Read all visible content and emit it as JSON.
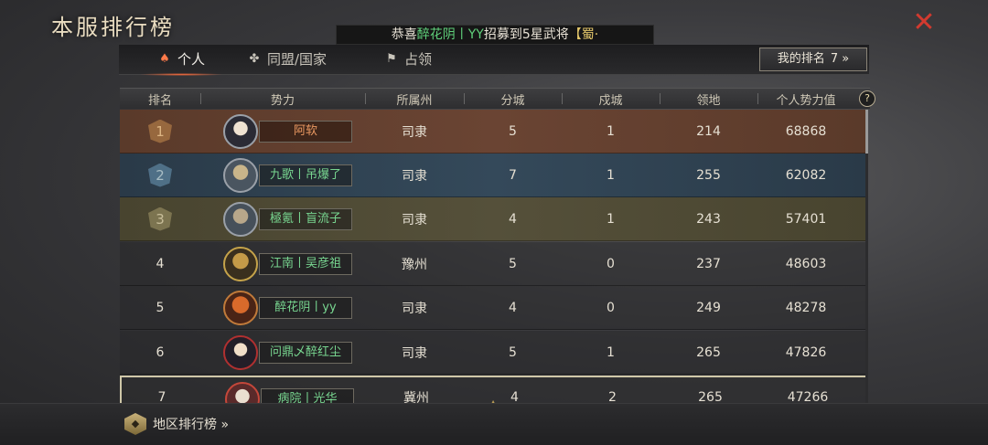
{
  "title": "本服排行榜",
  "close_icon": "close-x-icon",
  "marquee": {
    "prefix": "恭喜",
    "player": "醉花阴丨YY",
    "middle": "招募到5星武将",
    "tag": "【蜀·"
  },
  "tabs": [
    {
      "label": "个人",
      "icon": "person-icon",
      "active": true
    },
    {
      "label": "同盟/国家",
      "icon": "alliance-icon",
      "active": false
    },
    {
      "label": "占领",
      "icon": "flag-icon",
      "active": false
    }
  ],
  "my_rank": {
    "label": "我的排名",
    "value": "7",
    "arrow": "»"
  },
  "columns": {
    "rank": "排名",
    "faction": "势力",
    "state": "所属州",
    "sub_cities": "分城",
    "guard_cities": "戍城",
    "territory": "领地",
    "power": "个人势力值",
    "help": "?"
  },
  "rows": [
    {
      "rank": "1",
      "name": "阿软",
      "state": "司隶",
      "sub": "5",
      "guard": "1",
      "territory": "214",
      "power": "68868"
    },
    {
      "rank": "2",
      "name": "九歌丨吊爆了",
      "state": "司隶",
      "sub": "7",
      "guard": "1",
      "territory": "255",
      "power": "62082"
    },
    {
      "rank": "3",
      "name": "極氪丨盲流子",
      "state": "司隶",
      "sub": "4",
      "guard": "1",
      "territory": "243",
      "power": "57401"
    },
    {
      "rank": "4",
      "name": "江南丨吴彦祖",
      "state": "豫州",
      "sub": "5",
      "guard": "0",
      "territory": "237",
      "power": "48603"
    },
    {
      "rank": "5",
      "name": "醉花阴丨yy",
      "state": "司隶",
      "sub": "4",
      "guard": "0",
      "territory": "249",
      "power": "48278"
    },
    {
      "rank": "6",
      "name": "问鼎乄醉红尘",
      "state": "司隶",
      "sub": "5",
      "guard": "1",
      "territory": "265",
      "power": "47826"
    },
    {
      "rank": "7",
      "name": "病院丨光华",
      "state": "冀州",
      "sub": "4",
      "guard": "2",
      "territory": "265",
      "power": "47266"
    }
  ],
  "footer": {
    "region_link": "地区排行榜 »",
    "region_icon": "region-emblem-icon"
  }
}
